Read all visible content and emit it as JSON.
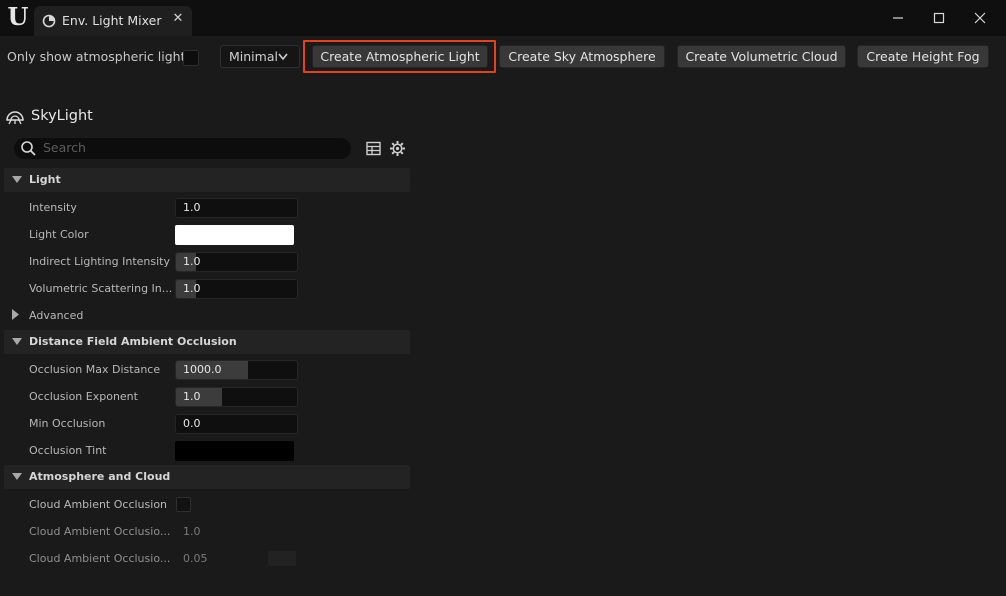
{
  "window": {
    "tab_title": "Env. Light Mixer",
    "logo": "unreal-logo",
    "buttons": [
      "minimize-icon",
      "maximize-icon",
      "close-icon"
    ]
  },
  "toolbar": {
    "only_show_label": "Only show atmospheric lights",
    "only_show_checked": false,
    "view_mode": "Minimal",
    "buttons": [
      "Create Atmospheric Light",
      "Create Sky Atmosphere",
      "Create Volumetric Cloud",
      "Create Height Fog"
    ],
    "highlight_color": "#e8401c"
  },
  "details": {
    "actor_name": "SkyLight",
    "search_placeholder": "Search",
    "categories": [
      {
        "label": "Light",
        "properties": [
          {
            "label": "Intensity",
            "value": "1.0"
          },
          {
            "label": "Light Color",
            "color": "#ffffff"
          },
          {
            "label": "Indirect Lighting Intensity",
            "value": "1.0"
          },
          {
            "label": "Volumetric Scattering In...",
            "value": "1.0"
          }
        ],
        "advanced_label": "Advanced"
      },
      {
        "label": "Distance Field Ambient Occlusion",
        "properties": [
          {
            "label": "Occlusion Max Distance",
            "value": "1000.0"
          },
          {
            "label": "Occlusion Exponent",
            "value": "1.0"
          },
          {
            "label": "Min Occlusion",
            "value": "0.0"
          },
          {
            "label": "Occlusion Tint",
            "color": "#000000"
          }
        ]
      },
      {
        "label": "Atmosphere and Cloud",
        "properties": [
          {
            "label": "Cloud Ambient Occlusion",
            "checked": false
          },
          {
            "label": "Cloud Ambient Occlusio...",
            "value": "1.0"
          },
          {
            "label": "Cloud Ambient Occlusio...",
            "value": "0.05"
          }
        ]
      }
    ]
  }
}
